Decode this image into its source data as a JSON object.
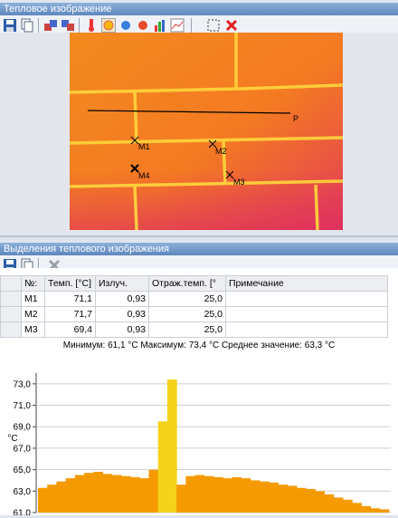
{
  "thermal_panel": {
    "title": "Тепловое изображение"
  },
  "markers": {
    "line": "P",
    "points": [
      "M1",
      "M2",
      "M3",
      "M4"
    ]
  },
  "selection_panel": {
    "title": "Выделения теплового изображения"
  },
  "table": {
    "headers": [
      "№:",
      "Темп. [°C]",
      "Излуч.",
      "Отраж.темп. [°",
      "Примечание"
    ],
    "rows": [
      [
        "M1",
        "71,1",
        "0,93",
        "25,0",
        ""
      ],
      [
        "M2",
        "71,7",
        "0,93",
        "25,0",
        ""
      ],
      [
        "M3",
        "69,4",
        "0,93",
        "25,0",
        ""
      ]
    ]
  },
  "stats_text": "Минимум: 61,1 °C Максимум: 73,4 °C Среднее значение: 63,3 °C",
  "colors": {
    "accent": "#5f87bd",
    "close_red": "#e02020",
    "histogram_orange": "#f59a00",
    "histogram_yellow": "#f5d21c"
  },
  "chart_data": {
    "type": "area",
    "ylabel": "°C",
    "ylim": [
      61.0,
      74.0
    ],
    "yticks": [
      "73,0",
      "71,0",
      "69,0",
      "67,0",
      "65,0",
      "63,0",
      "61,0"
    ],
    "grid": true,
    "profile": [
      63.3,
      63.6,
      63.9,
      64.2,
      64.5,
      64.7,
      64.8,
      64.6,
      64.5,
      64.4,
      64.3,
      64.2,
      65.0,
      69.5,
      73.4,
      63.6,
      64.4,
      64.5,
      64.4,
      64.3,
      64.2,
      64.3,
      64.2,
      64.0,
      63.9,
      63.8,
      63.6,
      63.5,
      63.3,
      63.2,
      63.0,
      62.7,
      62.4,
      62.2,
      61.9,
      61.6,
      61.4,
      61.3
    ]
  }
}
